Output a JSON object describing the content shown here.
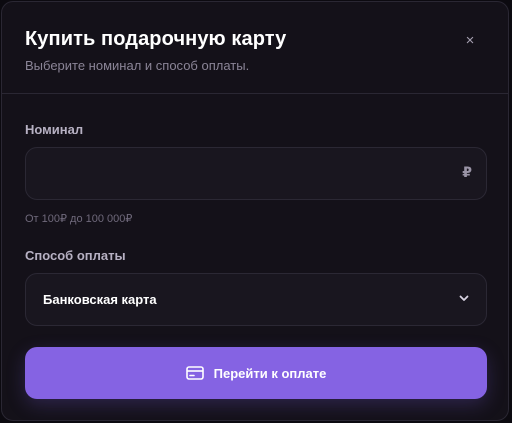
{
  "dialog": {
    "title": "Купить подарочную карту",
    "subtitle": "Выберите номинал и способ оплаты.",
    "close_symbol": "×"
  },
  "amount": {
    "label": "Номинал",
    "value": "",
    "placeholder": "",
    "currency_symbol": "₽",
    "hint": "От 100₽ до 100 000₽"
  },
  "payment": {
    "label": "Способ оплаты",
    "selected": "Банковская карта"
  },
  "submit": {
    "label": "Перейти к оплате",
    "icon": "credit-card-icon"
  },
  "colors": {
    "background": "#141119",
    "accent": "#8563e3",
    "border": "#2a2733"
  }
}
